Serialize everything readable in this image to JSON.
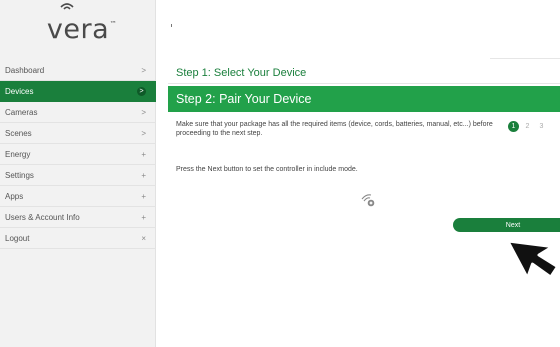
{
  "logo": {
    "text": "vera",
    "tm": "™"
  },
  "sidebar": {
    "items": [
      {
        "label": "Dashboard",
        "indicator": ">"
      },
      {
        "label": "Devices",
        "indicator": ">",
        "active": true
      },
      {
        "label": "Cameras",
        "indicator": ">"
      },
      {
        "label": "Scenes",
        "indicator": ">"
      },
      {
        "label": "Energy",
        "indicator": "+"
      },
      {
        "label": "Settings",
        "indicator": "+"
      },
      {
        "label": "Apps",
        "indicator": "+"
      },
      {
        "label": "Users & Account Info",
        "indicator": "+"
      },
      {
        "label": "Logout",
        "indicator": "×"
      }
    ]
  },
  "wizard": {
    "step1_title": "Step 1: Select Your Device",
    "step2_title": "Step 2: Pair Your Device",
    "description": "Make sure that your package has all the required items (device, cords, batteries, manual, etc...) before proceeding to the next step.",
    "instruction": "Press the Next button to set the controller in include mode.",
    "steps": [
      "1",
      "2",
      "3"
    ],
    "current_step": 1,
    "next_label": "Next"
  },
  "colors": {
    "brand_green": "#1a7f3c",
    "header_green": "#22a14a"
  },
  "icons": {
    "include_mode": "include-mode-icon",
    "cursor": "mouse-pointer-icon"
  }
}
